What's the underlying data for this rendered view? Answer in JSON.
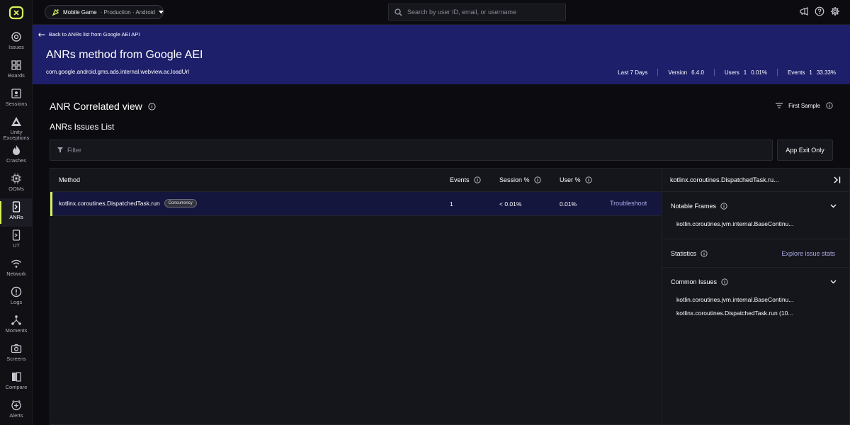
{
  "rail": {
    "items": [
      {
        "label": "Issues",
        "icon": "issues-icon"
      },
      {
        "label": "Boards",
        "icon": "boards-icon"
      },
      {
        "label": "Sessions",
        "icon": "sessions-icon"
      },
      {
        "label": "Unity Exceptions",
        "icon": "unity-icon"
      },
      {
        "label": "Crashes",
        "icon": "flame-icon"
      },
      {
        "label": "OOMs",
        "icon": "chip-icon"
      },
      {
        "label": "ANRs",
        "icon": "anr-icon"
      },
      {
        "label": "UT",
        "icon": "ut-icon"
      },
      {
        "label": "Network",
        "icon": "wifi-icon"
      },
      {
        "label": "Logs",
        "icon": "alert-circle-icon"
      },
      {
        "label": "Moments",
        "icon": "moments-icon"
      },
      {
        "label": "Screens",
        "icon": "camera-icon"
      },
      {
        "label": "Compare",
        "icon": "compare-icon"
      },
      {
        "label": "Alerts",
        "icon": "alerts-icon"
      }
    ],
    "active": "ANRs"
  },
  "topbar": {
    "app_name": "Mobile Game",
    "app_context": "· Production · Android",
    "search_placeholder": "Search by user ID, email, or username"
  },
  "header": {
    "back_label": "Back to ANRs list from Google AEI API",
    "title": "ANRs method from Google AEI",
    "subtitle": "com.google.android.gms.ads.internal.webview.ac.loadUrl",
    "range": "Last 7 Days",
    "version_label": "Version",
    "version_value": "6.4.0",
    "users_label": "Users",
    "users_count": "1",
    "users_pct": "0.01%",
    "events_label": "Events",
    "events_count": "1",
    "events_pct": "33.33%"
  },
  "main": {
    "title": "ANR Correlated view",
    "sample_label": "First Sample",
    "list_title": "ANRs Issues List",
    "filter_placeholder": "Filter",
    "exit_button": "App Exit Only"
  },
  "table": {
    "columns": {
      "method": "Method",
      "events": "Events",
      "session": "Session %",
      "user": "User %"
    },
    "rows": [
      {
        "method": "kotlinx.coroutines.DispatchedTask.run",
        "tag": "Concurrency",
        "events": "1",
        "session": "< 0.01%",
        "user": "0.01%",
        "action": "Troubleshoot"
      }
    ]
  },
  "side": {
    "title": "kotlinx.coroutines.DispatchedTask.ru...",
    "notable_title": "Notable Frames",
    "notable_items": [
      "kotlin.coroutines.jvm.internal.BaseContinu..."
    ],
    "stats_title": "Statistics",
    "stats_link": "Explore issue stats",
    "common_title": "Common Issues",
    "common_items": [
      "kotlin.coroutines.jvm.internal.BaseContinu...",
      "kotlinx.coroutines.DispatchedTask.run (10..."
    ]
  },
  "colors": {
    "accent": "#d6f25a",
    "banner": "#1d1f6a",
    "link": "#a9abe6"
  }
}
